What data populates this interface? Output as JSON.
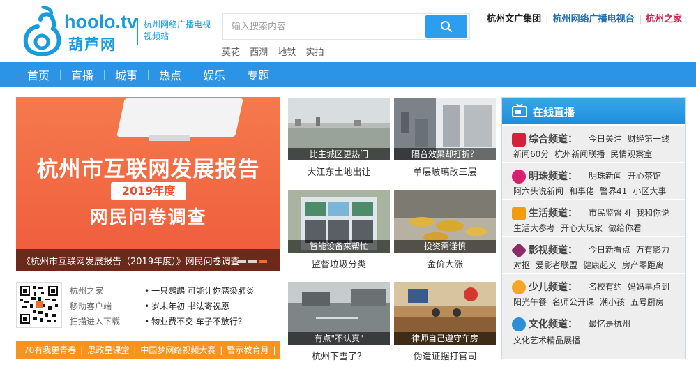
{
  "header": {
    "logo_text": "hoolo.tv",
    "logo_sub": "葫芦网",
    "tagline": "杭州网络广播电视视频站",
    "search": {
      "placeholder": "输入搜索内容"
    },
    "hot_words": [
      "莫花",
      "西湖",
      "地铁",
      "实拍"
    ],
    "top_links": [
      "杭州文广集团",
      "杭州网络广播电视台",
      "杭州之家"
    ]
  },
  "nav": {
    "items": [
      "首页",
      "直播",
      "城事",
      "热点",
      "娱乐",
      "专题"
    ]
  },
  "banner": {
    "title": "杭州市互联网发展报告",
    "year": "2019年度",
    "subtitle": "网民问卷调查",
    "caption": "《杭州市互联网发展报告（2019年度）》网民问卷调查"
  },
  "qr_block": {
    "links": [
      "杭州之家",
      "移动客户端",
      "扫描进入下载"
    ],
    "news": [
      "一只鹦鹉 可能让你感染肺炎",
      "岁末年初 书法寄祝愿",
      "物业费不交 车子不放行？"
    ]
  },
  "orange_bar": {
    "items": [
      "70有我更青春",
      "思政星课堂",
      "中国梦网络视频大赛",
      "警示教育月"
    ]
  },
  "thumbs": [
    {
      "caption": "比主城区更热门",
      "label": "大江东土地出让"
    },
    {
      "caption": "隔音效果却打折？",
      "label": "单层玻璃改三层"
    },
    {
      "caption": "智能设备来帮忙",
      "label": "监督垃圾分类"
    },
    {
      "caption": "投资需谨慎",
      "label": "金价大涨"
    },
    {
      "caption": "有点\"不认真\"",
      "label": "杭州下雪了？"
    },
    {
      "caption": "律师自己遵守车房",
      "label": "伪造证据打官司"
    }
  ],
  "live": {
    "title": "在线直播",
    "channels": [
      {
        "name": "综合频道：",
        "color": "#d6213b",
        "line1": [
          "今日关注",
          "财经第一线"
        ],
        "line2": [
          "新闻60分",
          "杭州新闻联播",
          "民情观察室"
        ]
      },
      {
        "name": "明珠频道：",
        "color": "#d6216f",
        "line1": [
          "明珠新闻",
          "开心茶馆"
        ],
        "line2": [
          "阿六头说新闻",
          "和事佬",
          "警界41",
          "小区大事"
        ]
      },
      {
        "name": "生活频道：",
        "color": "#f39c12",
        "line1": [
          "市民监督团",
          "我和你说"
        ],
        "line2": [
          "生活大参考",
          "开心大玩家",
          "做给你看"
        ]
      },
      {
        "name": "影视频道：",
        "color": "#8e2a6b",
        "line1": [
          "今日新看点",
          "万有影力"
        ],
        "line2": [
          "对抠",
          "爱影者联盟",
          "健康起义",
          "房产零距离"
        ]
      },
      {
        "name": "少儿频道：",
        "color": "#f5a623",
        "line1": [
          "名校有约",
          "妈妈早点到"
        ],
        "line2": [
          "阳光午餐",
          "名师公开课",
          "潮小孩",
          "五号厨房"
        ]
      },
      {
        "name": "文化频道：",
        "color": "#2a8fd6",
        "line1": [
          "最忆是杭州"
        ],
        "line2": [
          "文化艺术精品展播"
        ]
      }
    ]
  }
}
